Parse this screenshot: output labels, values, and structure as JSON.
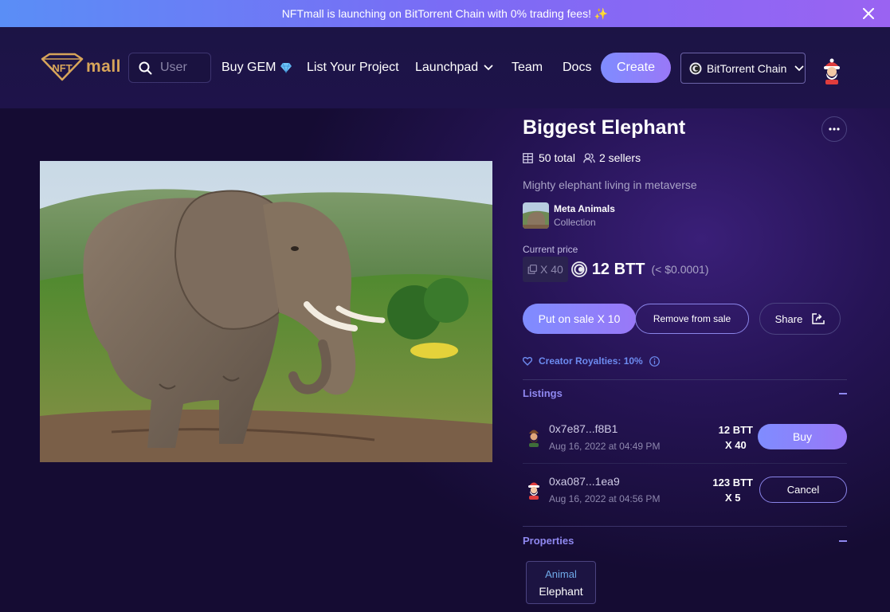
{
  "banner": {
    "text": "NFTmall is launching on BitTorrent Chain with 0% trading fees! ✨"
  },
  "nav": {
    "logo_prefix": "NFT",
    "logo_suffix": "mall",
    "search_placeholder": "User",
    "buy_gem": "Buy GEM",
    "list_project": "List Your Project",
    "launchpad": "Launchpad",
    "team": "Team",
    "docs": "Docs",
    "create": "Create",
    "chain": "BitTorrent Chain"
  },
  "nft": {
    "title": "Biggest Elephant",
    "total": "50 total",
    "sellers": "2 sellers",
    "description": "Mighty elephant living in metaverse",
    "collection_name": "Meta Animals",
    "collection_label": "Collection",
    "price_label": "Current price",
    "quantity": "X 40",
    "price": "12 BTT",
    "price_usd": "(< $0.0001)"
  },
  "actions": {
    "put_on_sale": "Put on sale X 10",
    "remove_from_sale": "Remove from sale",
    "share": "Share"
  },
  "royalties": "Creator Royalties: 10%",
  "listings": {
    "heading": "Listings",
    "items": [
      {
        "address": "0x7e87...f8B1",
        "date": "Aug 16, 2022 at 04:49 PM",
        "price": "12 BTT",
        "qty": "X 40",
        "action": "Buy"
      },
      {
        "address": "0xa087...1ea9",
        "date": "Aug 16, 2022 at 04:56 PM",
        "price": "123 BTT",
        "qty": "X 5",
        "action": "Cancel"
      }
    ]
  },
  "properties": {
    "heading": "Properties",
    "items": [
      {
        "type": "Animal",
        "value": "Elephant"
      }
    ]
  },
  "colors": {
    "accent": "#8f88f0",
    "button_gradient_start": "#7f8cff",
    "button_gradient_end": "#9978f7",
    "background": "#150c33"
  },
  "icons": [
    "close-icon",
    "search-icon",
    "gem-icon",
    "chevron-down-icon",
    "bittorrent-icon",
    "more-icon",
    "grid-icon",
    "users-icon",
    "copy-icon",
    "share-icon",
    "heart-icon",
    "info-icon"
  ]
}
